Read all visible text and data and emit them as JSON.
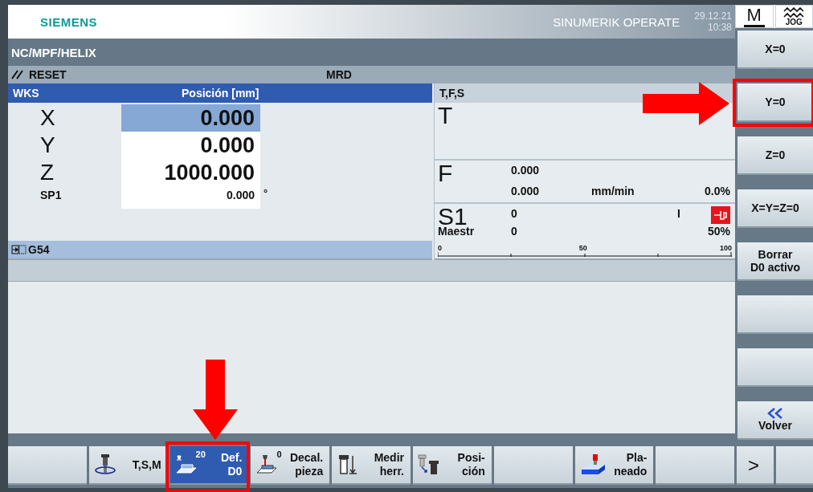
{
  "header": {
    "brand": "SIEMENS",
    "product": "SINUMERIK OPERATE",
    "date": "29.12.21",
    "time": "10:38",
    "mode_keys": [
      {
        "kind": "machine",
        "label": "M"
      },
      {
        "kind": "jog",
        "label": "JOG"
      }
    ]
  },
  "program_path": "NC/MPF/HELIX",
  "status": {
    "reset": "RESET",
    "mode": "MRD"
  },
  "position_panel": {
    "columns": [
      "WKS",
      "Posición [mm]"
    ],
    "axes": [
      {
        "kind": "main",
        "name": "X",
        "value": "0.000",
        "selected": true
      },
      {
        "kind": "main",
        "name": "Y",
        "value": "0.000",
        "selected": false
      },
      {
        "kind": "main",
        "name": "Z",
        "value": "1000.000",
        "selected": false
      },
      {
        "kind": "spindle",
        "name": "SP1",
        "value": "0.000",
        "unit": "°",
        "selected": false
      }
    ],
    "frame": "G54"
  },
  "tfs_panel": {
    "title": "T,F,S",
    "tool": {
      "label": "T"
    },
    "feed": {
      "label": "F",
      "value": "0.000",
      "actual": "0.000",
      "unit": "mm/min",
      "override": "0.0%"
    },
    "spindle": {
      "label": "S1",
      "value": "0",
      "direction": "I",
      "sub_label": "Maestr",
      "actual": "0",
      "override": "50%",
      "scale": [
        "0",
        "50",
        "100"
      ]
    }
  },
  "vertical_softkeys": [
    {
      "lines": [
        "X=0"
      ],
      "highlighted": false
    },
    {
      "lines": [
        "Y=0"
      ],
      "highlighted": true
    },
    {
      "lines": [
        "Z=0"
      ],
      "highlighted": false
    },
    {
      "lines": [
        "X=Y=Z=0"
      ],
      "highlighted": false
    },
    {
      "lines": [
        "Borrar",
        "D0 activo"
      ],
      "highlighted": false
    },
    {
      "highlighted": false
    },
    {
      "highlighted": false
    },
    {
      "lines": [
        "Volver"
      ],
      "highlighted": false
    }
  ],
  "horizontal_softkeys": [
    {
      "selected": false,
      "highlighted": false
    },
    {
      "lines": [
        "T,S,M"
      ],
      "selected": false,
      "highlighted": false
    },
    {
      "lines": [
        "Def.",
        "D0"
      ],
      "icon_text": "20",
      "selected": true,
      "highlighted": true
    },
    {
      "lines": [
        "Decal.",
        "pieza"
      ],
      "icon_text": "0",
      "selected": false,
      "highlighted": false
    },
    {
      "lines": [
        "Medir",
        "herr."
      ],
      "selected": false,
      "highlighted": false
    },
    {
      "lines": [
        "Posi-",
        "ción"
      ],
      "selected": false,
      "highlighted": false
    },
    {
      "selected": false,
      "highlighted": false
    },
    {
      "lines": [
        "Pla-",
        "neado"
      ],
      "selected": false,
      "highlighted": false
    },
    {
      "selected": false,
      "highlighted": false
    },
    {
      "lines": [
        ">"
      ],
      "selected": false,
      "highlighted": false
    },
    {
      "selected": false,
      "highlighted": false
    }
  ]
}
